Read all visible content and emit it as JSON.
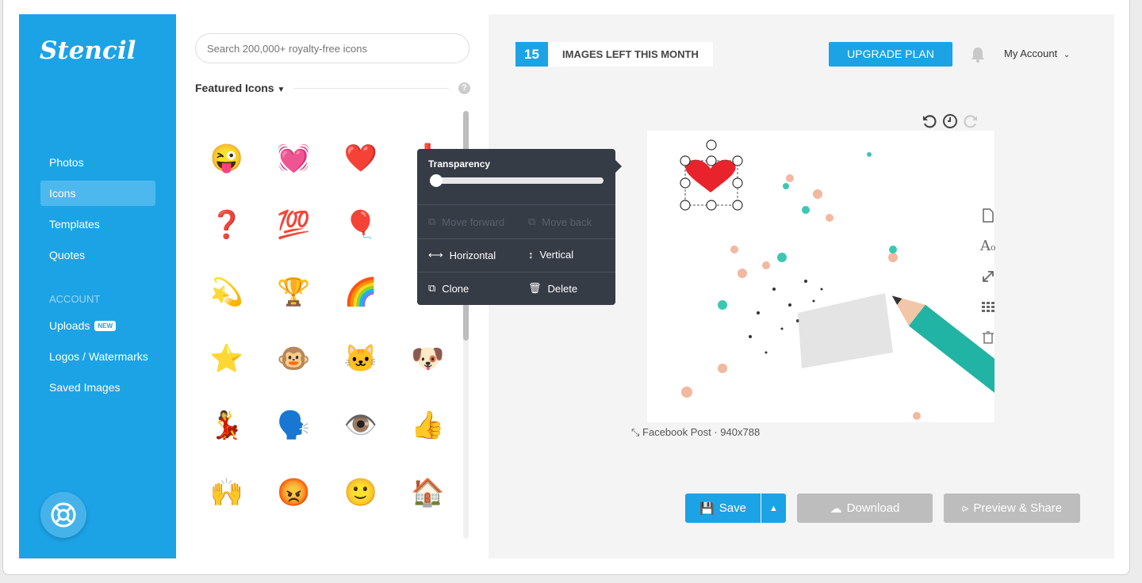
{
  "app": {
    "logo": "Stencil",
    "brand_color": "#1ca3e6"
  },
  "sidebar": {
    "items": [
      {
        "label": "Photos"
      },
      {
        "label": "Icons",
        "active": true
      },
      {
        "label": "Templates"
      },
      {
        "label": "Quotes"
      }
    ],
    "account_header": "ACCOUNT",
    "account_items": [
      {
        "label": "Uploads",
        "badge": "NEW"
      },
      {
        "label": "Logos / Watermarks"
      },
      {
        "label": "Saved Images"
      }
    ],
    "help_icon": "life-ring-icon"
  },
  "panel": {
    "search_placeholder": "Search 200,000+ royalty-free icons",
    "section_title": "Featured Icons",
    "help": "?",
    "icons": [
      [
        "😜",
        "💓",
        "❤️",
        "❗"
      ],
      [
        "❓",
        "💯",
        "🎈",
        ""
      ],
      [
        "💫",
        "🏆",
        "🌈",
        ""
      ],
      [
        "⭐",
        "🐵",
        "🐱",
        "🐶"
      ],
      [
        "💃",
        "🗣️",
        "👁️",
        "👍"
      ],
      [
        "🙌",
        "😡",
        "🙂",
        "🏠"
      ],
      [
        "🌳",
        "🌵",
        "🍉",
        "🍏"
      ]
    ]
  },
  "header": {
    "images_left": "15",
    "images_left_label": "IMAGES LEFT THIS MONTH",
    "upgrade": "UPGRADE PLAN",
    "account": "My Account"
  },
  "canvas": {
    "info": "Facebook Post · 940x788"
  },
  "popup": {
    "transparency_label": "Transparency",
    "transparency_value": 0,
    "move_forward": "Move forward",
    "move_back": "Move back",
    "horizontal": "Horizontal",
    "vertical": "Vertical",
    "clone": "Clone",
    "delete": "Delete"
  },
  "actions": {
    "save": "Save",
    "download": "Download",
    "preview_share": "Preview & Share"
  }
}
